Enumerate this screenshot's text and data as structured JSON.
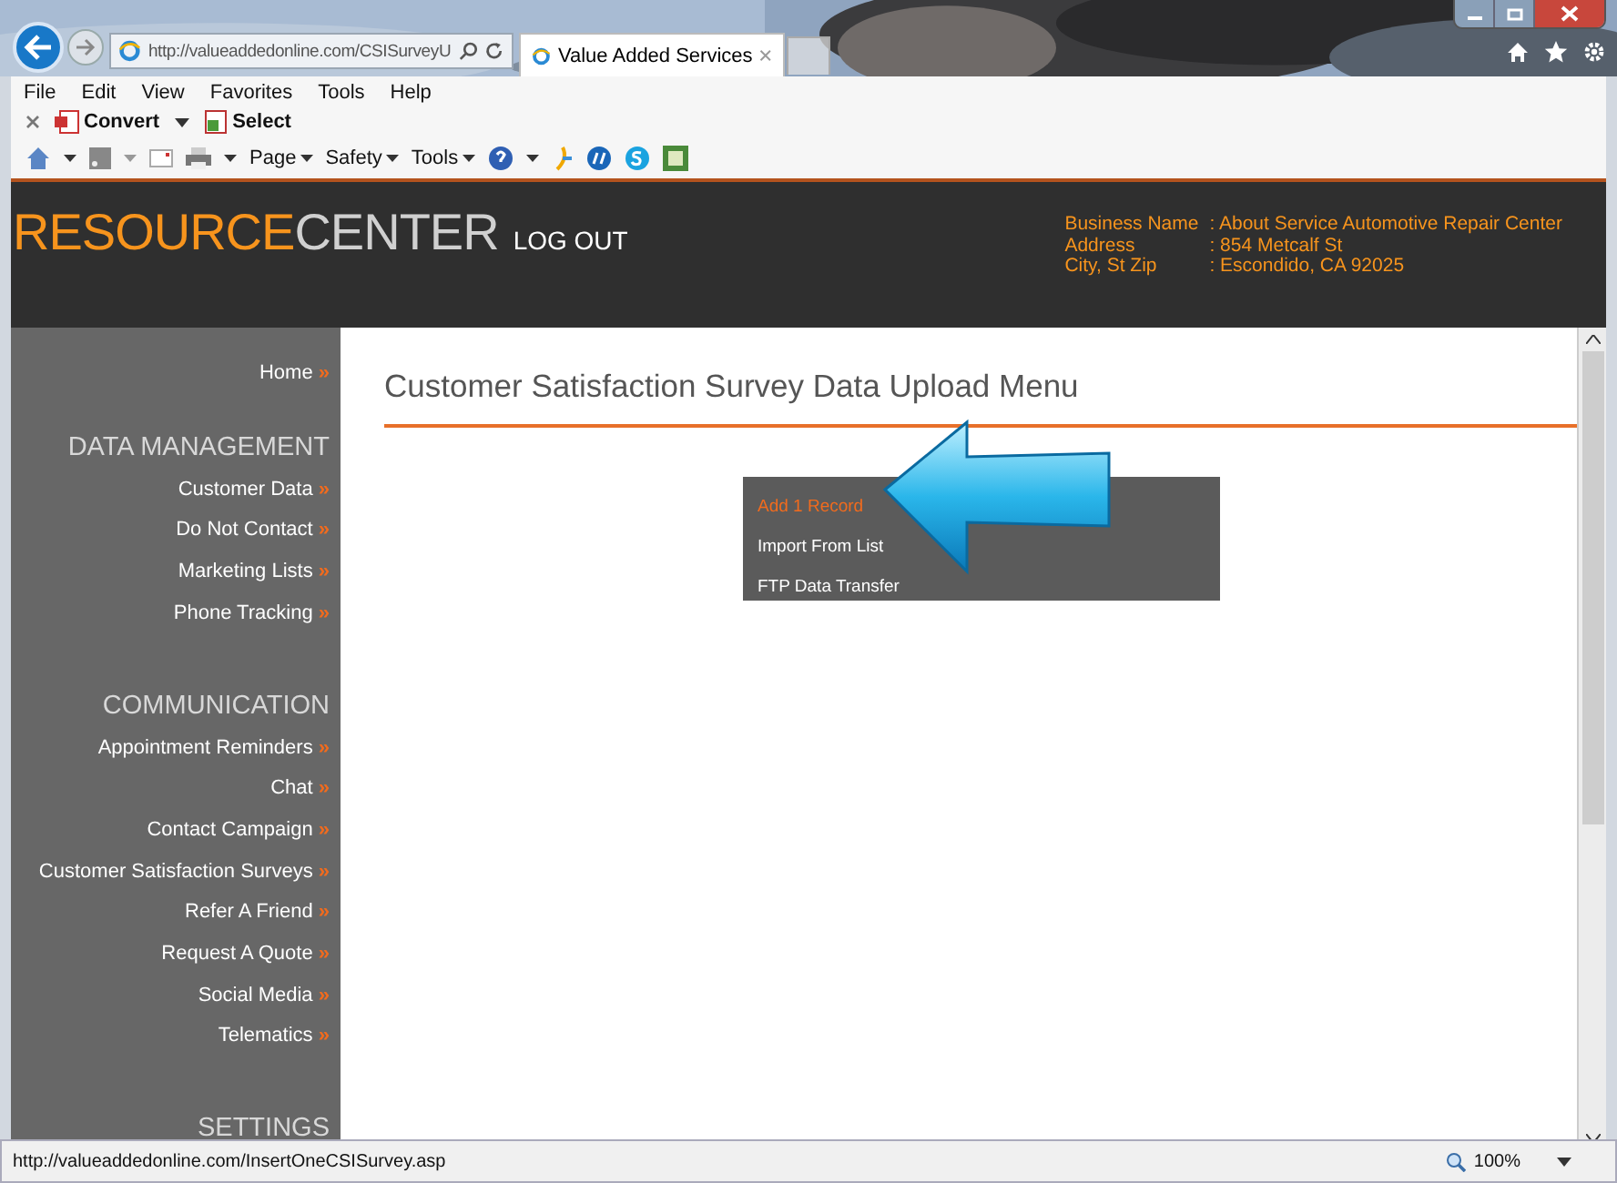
{
  "browser": {
    "address": "http://valueaddedonline.com/CSISurveyU",
    "tab": {
      "title": "Value Added Services",
      "selected": true
    },
    "menu_bar": [
      "File",
      "Edit",
      "View",
      "Favorites",
      "Tools",
      "Help"
    ],
    "toolbar_1": [
      {
        "label": "Convert",
        "kind": "pdf"
      },
      {
        "label": "Select",
        "kind": "select"
      }
    ],
    "toolbar_2": [
      "Page",
      "Safety",
      "Tools"
    ],
    "status_bar": {
      "url": "http://valueaddedonline.com/InsertOneCSISurvey.asp",
      "zoom": "100%"
    }
  },
  "header": {
    "logo_accent": "RESOURCE",
    "logo_rest": "CENTER",
    "logout": "LOG OUT",
    "info": [
      {
        "label": "Business Name",
        "value": ": About Service Automotive Repair Center"
      },
      {
        "label": "Address",
        "value": ": 854 Metcalf St"
      },
      {
        "label": "City, St Zip",
        "value": ": Escondido, CA 92025"
      }
    ]
  },
  "sidebar": {
    "sections": [
      {
        "items": [
          "Home"
        ]
      },
      {
        "heading": "DATA MANAGEMENT",
        "items": [
          "Customer Data",
          "Do Not Contact",
          "Marketing Lists",
          "Phone Tracking"
        ]
      },
      {
        "heading": "COMMUNICATION",
        "items": [
          "Appointment Reminders",
          "Chat",
          "Contact Campaign",
          "Customer Satisfaction Surveys",
          "Refer A Friend",
          "Request A Quote",
          "Social Media",
          "Telematics"
        ]
      },
      {
        "heading": "SETTINGS"
      }
    ],
    "marker": "»"
  },
  "content": {
    "title": "Customer Satisfaction Survey Data Upload Menu",
    "menu": [
      {
        "label": "Add 1 Record",
        "selected": true
      },
      {
        "label": "Import From List",
        "selected": false
      },
      {
        "label": "FTP Data Transfer",
        "selected": false
      }
    ]
  }
}
